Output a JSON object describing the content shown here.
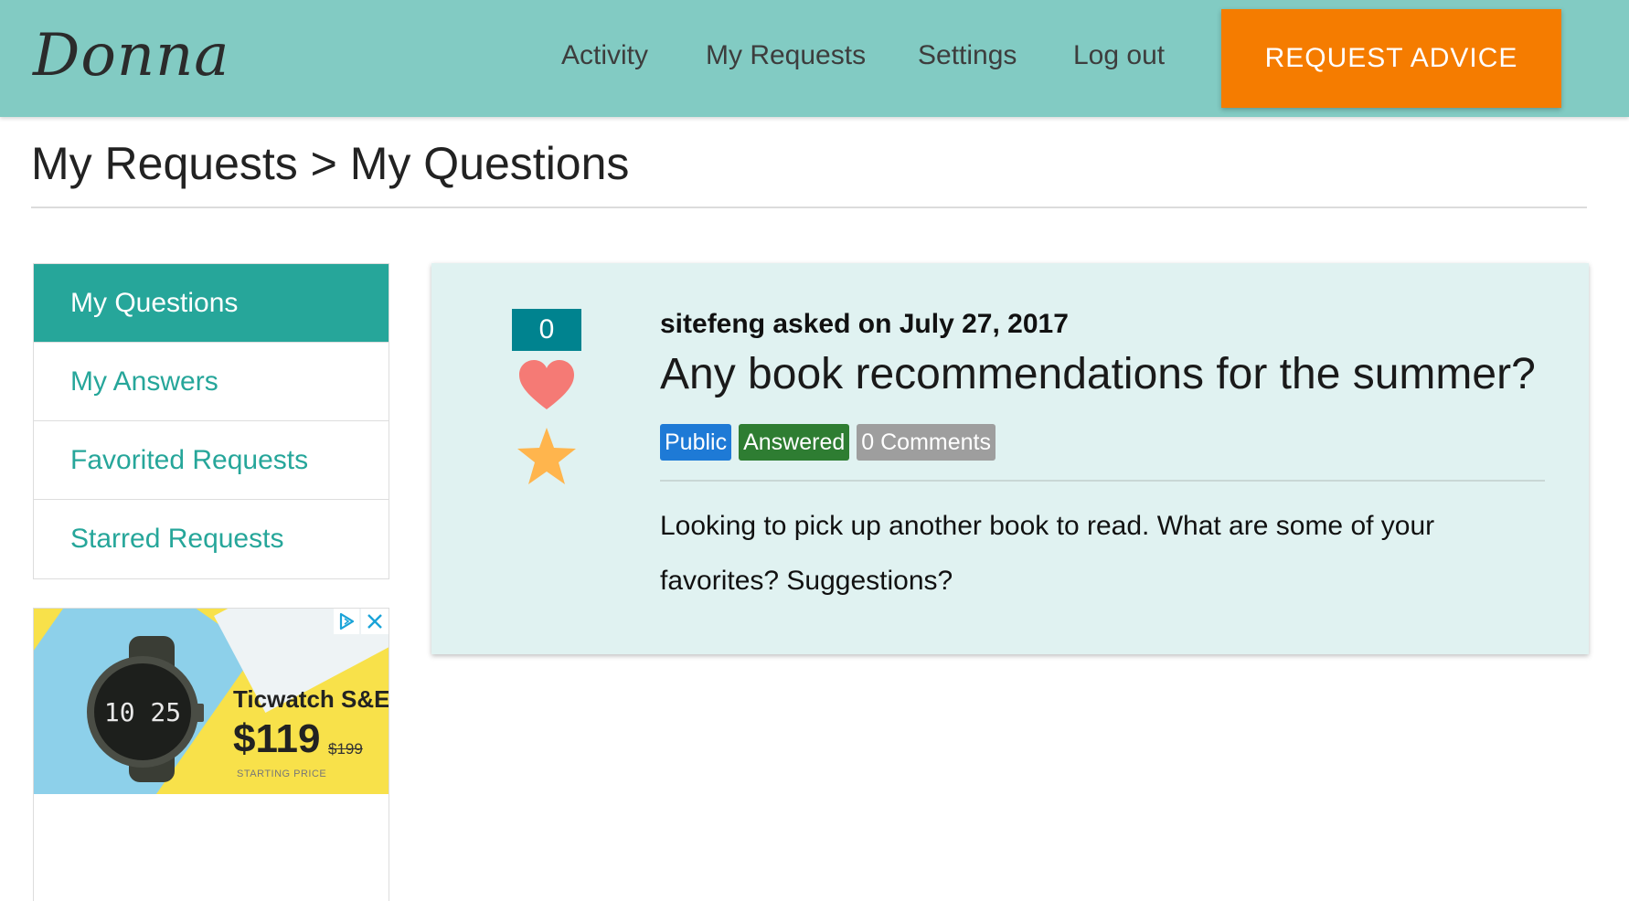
{
  "header": {
    "brand": "Donna",
    "nav": [
      "Activity",
      "My Requests",
      "Settings",
      "Log out"
    ],
    "cta_label": "REQUEST ADVICE",
    "bg_color": "#82cbc3",
    "cta_color": "#f57c00"
  },
  "page": {
    "title": "My Requests > My Questions"
  },
  "sidebar": {
    "items": [
      {
        "label": "My Questions",
        "active": true
      },
      {
        "label": "My Answers",
        "active": false
      },
      {
        "label": "Favorited Requests",
        "active": false
      },
      {
        "label": "Starred Requests",
        "active": false
      }
    ],
    "accent_color": "#26a69a"
  },
  "ad": {
    "product": "Ticwatch S&E",
    "price": "$119",
    "old_price": "$199",
    "caption": "STARTING PRICE",
    "watch_time": "10 25",
    "icons": [
      "adchoices-icon",
      "close-icon"
    ]
  },
  "question": {
    "count": "0",
    "meta": "sitefeng asked on July 27, 2017",
    "title": "Any book recommendations for the summer?",
    "tags": [
      "Public",
      "Answered",
      "0 Comments"
    ],
    "body": "Looking to pick up another book to read. What are some of your favorites? Suggestions?",
    "icons": [
      "heart-icon",
      "star-icon"
    ]
  }
}
